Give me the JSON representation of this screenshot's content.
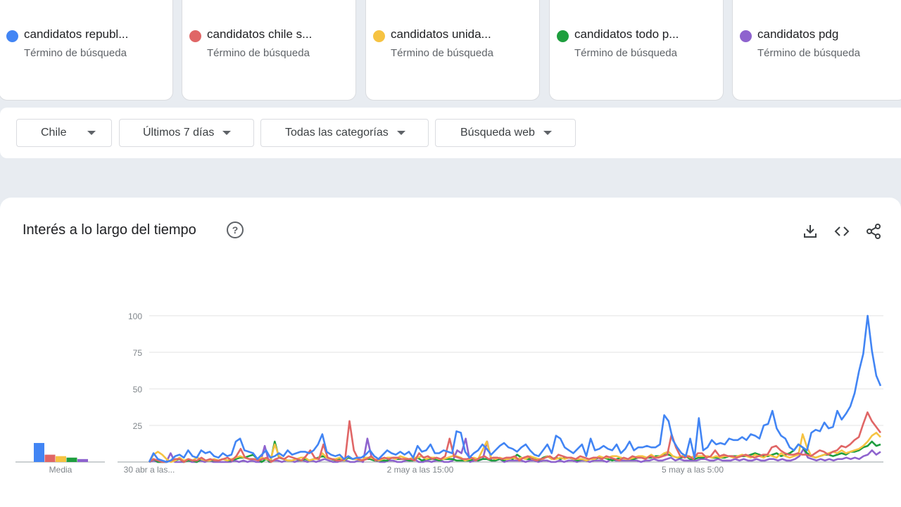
{
  "search_terms": [
    {
      "name": "candidatos republ...",
      "subtitle": "Término de búsqueda",
      "color": "#4285f4"
    },
    {
      "name": "candidatos chile s...",
      "subtitle": "Término de búsqueda",
      "color": "#e06666"
    },
    {
      "name": "candidatos unida...",
      "subtitle": "Término de búsqueda",
      "color": "#f6c342"
    },
    {
      "name": "candidatos todo p...",
      "subtitle": "Término de búsqueda",
      "color": "#1e9e3e"
    },
    {
      "name": "candidatos pdg",
      "subtitle": "Término de búsqueda",
      "color": "#8e63ce"
    }
  ],
  "filters": {
    "region": "Chile",
    "time_range": "Últimos 7 días",
    "category": "Todas las categorías",
    "search_type": "Búsqueda web"
  },
  "panel": {
    "title": "Interés a lo largo del tiempo",
    "help_icon": "?",
    "tools": [
      "download-icon",
      "embed-icon",
      "share-icon"
    ]
  },
  "chart_data": {
    "type": "line",
    "title": "",
    "x_labels": [
      "30 abr a las...",
      "2 may a las 15:00",
      "5 may a las 5:00"
    ],
    "y_ticks": [
      25,
      50,
      75,
      100
    ],
    "ylim": [
      0,
      100
    ],
    "grid": true,
    "average_label": "Media",
    "averages": [
      13,
      5,
      4,
      3,
      2
    ],
    "series": [
      {
        "name": "candidatos republ...",
        "color": "#4285f4",
        "values": [
          0,
          6,
          2,
          1,
          0,
          1,
          4,
          5,
          3,
          8,
          4,
          3,
          8,
          6,
          7,
          4,
          3,
          6,
          4,
          5,
          14,
          16,
          8,
          7,
          6,
          2,
          5,
          8,
          3,
          4,
          6,
          4,
          8,
          5,
          6,
          7,
          7,
          6,
          8,
          12,
          19,
          7,
          5,
          4,
          5,
          2,
          4,
          2,
          3,
          3,
          5,
          8,
          4,
          2,
          5,
          8,
          6,
          5,
          7,
          5,
          7,
          3,
          11,
          7,
          8,
          12,
          6,
          6,
          8,
          7,
          6,
          21,
          20,
          7,
          3,
          6,
          8,
          12,
          9,
          5,
          8,
          11,
          13,
          10,
          9,
          7,
          10,
          12,
          8,
          5,
          4,
          8,
          12,
          6,
          18,
          16,
          10,
          8,
          6,
          9,
          12,
          4,
          16,
          8,
          9,
          11,
          9,
          8,
          12,
          6,
          9,
          14,
          8,
          10,
          10,
          11,
          10,
          10,
          12,
          32,
          28,
          15,
          10,
          6,
          4,
          16,
          3,
          30,
          8,
          10,
          15,
          12,
          13,
          12,
          16,
          15,
          15,
          17,
          15,
          19,
          18,
          16,
          25,
          26,
          35,
          23,
          18,
          16,
          10,
          8,
          12,
          10,
          8,
          20,
          22,
          21,
          27,
          23,
          24,
          35,
          29,
          33,
          38,
          47,
          62,
          74,
          100,
          76,
          59,
          52
        ]
      },
      {
        "name": "candidatos chile s...",
        "color": "#e06666",
        "values": [
          0,
          2,
          1,
          0,
          0,
          1,
          2,
          2,
          0,
          2,
          1,
          1,
          3,
          1,
          2,
          1,
          1,
          2,
          3,
          1,
          4,
          9,
          3,
          2,
          2,
          1,
          2,
          3,
          0,
          2,
          3,
          2,
          4,
          3,
          2,
          1,
          4,
          8,
          3,
          2,
          12,
          3,
          2,
          1,
          1,
          2,
          28,
          8,
          2,
          1,
          2,
          4,
          1,
          2,
          3,
          2,
          3,
          3,
          2,
          2,
          2,
          1,
          6,
          3,
          4,
          2,
          3,
          2,
          4,
          16,
          4,
          3,
          2,
          2,
          3,
          1,
          3,
          4,
          2,
          3,
          3,
          2,
          3,
          3,
          4,
          1,
          3,
          4,
          2,
          1,
          2,
          3,
          4,
          2,
          5,
          4,
          3,
          3,
          2,
          4,
          3,
          2,
          3,
          3,
          2,
          4,
          3,
          2,
          1,
          3,
          2,
          4,
          3,
          3,
          2,
          4,
          3,
          3,
          4,
          5,
          19,
          10,
          4,
          3,
          4,
          2,
          6,
          6,
          3,
          4,
          8,
          4,
          5,
          4,
          4,
          3,
          4,
          5,
          4,
          3,
          4,
          5,
          5,
          10,
          11,
          8,
          6,
          5,
          5,
          6,
          5,
          5,
          4,
          6,
          8,
          7,
          5,
          7,
          8,
          11,
          10,
          12,
          15,
          17,
          26,
          34,
          28,
          24,
          20
        ]
      },
      {
        "name": "candidatos unida...",
        "color": "#f6c342",
        "values": [
          0,
          5,
          7,
          5,
          2,
          0,
          1,
          3,
          1,
          2,
          1,
          3,
          2,
          1,
          1,
          2,
          1,
          2,
          1,
          2,
          3,
          4,
          3,
          2,
          2,
          2,
          3,
          2,
          1,
          12,
          4,
          2,
          1,
          1,
          2,
          3,
          3,
          1,
          2,
          2,
          6,
          3,
          2,
          2,
          3,
          1,
          4,
          2,
          2,
          1,
          3,
          3,
          2,
          1,
          2,
          3,
          3,
          2,
          4,
          3,
          2,
          3,
          3,
          4,
          2,
          3,
          3,
          2,
          2,
          3,
          4,
          4,
          3,
          1,
          2,
          3,
          2,
          8,
          14,
          3,
          2,
          3,
          2,
          2,
          3,
          2,
          3,
          2,
          4,
          3,
          2,
          2,
          4,
          2,
          2,
          3,
          2,
          3,
          2,
          2,
          2,
          1,
          2,
          2,
          4,
          3,
          3,
          4,
          4,
          3,
          2,
          2,
          3,
          4,
          4,
          3,
          5,
          3,
          4,
          6,
          7,
          4,
          3,
          4,
          5,
          3,
          4,
          4,
          4,
          4,
          3,
          4,
          3,
          4,
          4,
          3,
          4,
          5,
          4,
          3,
          5,
          4,
          3,
          5,
          4,
          3,
          6,
          4,
          3,
          4,
          5,
          19,
          10,
          4,
          3,
          4,
          5,
          6,
          7,
          6,
          8,
          6,
          7,
          8,
          9,
          11,
          14,
          18,
          20,
          17
        ]
      },
      {
        "name": "candidatos todo p...",
        "color": "#1e9e3e",
        "values": [
          0,
          2,
          0,
          0,
          0,
          1,
          1,
          2,
          0,
          1,
          1,
          0,
          2,
          1,
          1,
          1,
          1,
          2,
          1,
          1,
          2,
          3,
          3,
          4,
          5,
          2,
          0,
          2,
          0,
          14,
          3,
          2,
          1,
          1,
          2,
          1,
          2,
          1,
          2,
          3,
          4,
          3,
          2,
          1,
          2,
          1,
          3,
          2,
          2,
          1,
          2,
          2,
          1,
          1,
          1,
          1,
          3,
          2,
          2,
          2,
          1,
          1,
          3,
          1,
          2,
          2,
          2,
          1,
          2,
          2,
          2,
          1,
          1,
          1,
          1,
          2,
          1,
          2,
          2,
          1,
          1,
          2,
          1,
          3,
          2,
          5,
          3,
          2,
          2,
          3,
          1,
          3,
          4,
          2,
          3,
          2,
          3,
          3,
          2,
          1,
          2,
          1,
          2,
          2,
          3,
          3,
          2,
          1,
          2,
          3,
          2,
          2,
          2,
          3,
          3,
          3,
          3,
          4,
          4,
          5,
          5,
          4,
          3,
          3,
          4,
          2,
          2,
          3,
          3,
          4,
          3,
          3,
          3,
          3,
          4,
          4,
          4,
          4,
          4,
          5,
          6,
          5,
          4,
          4,
          5,
          6,
          4,
          5,
          6,
          8,
          12,
          10,
          6,
          4,
          3,
          4,
          5,
          5,
          4,
          5,
          6,
          5,
          7,
          7,
          8,
          10,
          11,
          14,
          11,
          12
        ]
      },
      {
        "name": "candidatos pdg",
        "color": "#8e63ce",
        "values": [
          0,
          1,
          0,
          0,
          0,
          6,
          0,
          0,
          0,
          1,
          0,
          0,
          1,
          0,
          1,
          0,
          0,
          0,
          0,
          0,
          1,
          0,
          1,
          0,
          1,
          0,
          0,
          11,
          0,
          1,
          1,
          0,
          1,
          1,
          0,
          1,
          1,
          0,
          1,
          0,
          1,
          2,
          1,
          0,
          0,
          1,
          1,
          0,
          0,
          1,
          0,
          16,
          3,
          1,
          0,
          0,
          1,
          1,
          0,
          0,
          1,
          1,
          2,
          0,
          0,
          1,
          0,
          1,
          1,
          0,
          0,
          1,
          8,
          6,
          16,
          0,
          1,
          1,
          2,
          14,
          1,
          1,
          2,
          0,
          1,
          1,
          1,
          1,
          0,
          1,
          1,
          0,
          1,
          1,
          0,
          0,
          1,
          0,
          1,
          1,
          0,
          1,
          1,
          0,
          1,
          1,
          1,
          0,
          2,
          1,
          1,
          1,
          1,
          1,
          1,
          0,
          1,
          1,
          2,
          1,
          1,
          2,
          3,
          1,
          2,
          1,
          1,
          1,
          1,
          2,
          2,
          1,
          1,
          2,
          1,
          1,
          1,
          2,
          1,
          2,
          1,
          1,
          2,
          1,
          1,
          2,
          2,
          1,
          2,
          1,
          1,
          2,
          4,
          9,
          3,
          2,
          1,
          2,
          1,
          2,
          1,
          2,
          2,
          3,
          2,
          3,
          2,
          4,
          5,
          8,
          5,
          7
        ]
      }
    ]
  }
}
